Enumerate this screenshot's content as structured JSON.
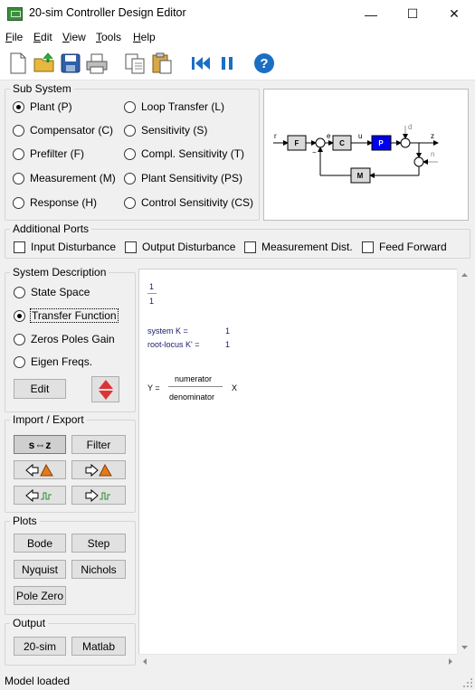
{
  "window": {
    "title": "20-sim Controller Design Editor",
    "minimize": "—",
    "maximize": "☐",
    "close": "✕"
  },
  "menu": [
    {
      "label": "File",
      "u": "F",
      "rest": "ile"
    },
    {
      "label": "Edit",
      "u": "E",
      "rest": "dit"
    },
    {
      "label": "View",
      "u": "V",
      "rest": "iew"
    },
    {
      "label": "Tools",
      "u": "T",
      "rest": "ools"
    },
    {
      "label": "Help",
      "u": "H",
      "rest": "elp"
    }
  ],
  "toolbar": [
    "new-file-icon",
    "open-folder-icon",
    "save-icon",
    "print-icon",
    "copy-icon",
    "paste-icon",
    "rewind-icon",
    "pause-icon",
    "help-icon"
  ],
  "subsystem": {
    "title": "Sub System",
    "left": [
      "Plant (P)",
      "Compensator (C)",
      "Prefilter (F)",
      "Measurement (M)",
      "Response (H)"
    ],
    "right": [
      "Loop Transfer (L)",
      "Sensitivity (S)",
      "Compl. Sensitivity (T)",
      "Plant Sensitivity (PS)",
      "Control Sensitivity (CS)"
    ],
    "selected": "Plant (P)"
  },
  "diagram": {
    "labels": {
      "r": "r",
      "F": "F",
      "e": "e",
      "C": "C",
      "u": "u",
      "P": "P",
      "z": "z",
      "d": "d",
      "n": "n",
      "M": "M",
      "minus": "−"
    }
  },
  "ports": {
    "title": "Additional Ports",
    "items": [
      "Input Disturbance",
      "Output Disturbance",
      "Measurement Dist.",
      "Feed Forward"
    ]
  },
  "sysdesc": {
    "title": "System Description",
    "options": [
      "State Space",
      "Transfer Function",
      "Zeros Poles Gain",
      "Eigen Freqs."
    ],
    "selected": "Transfer Function",
    "edit_label": "Edit"
  },
  "importexport": {
    "title": "Import / Export",
    "sz_label": "s⇔z",
    "filter_label": "Filter"
  },
  "plots": {
    "title": "Plots",
    "buttons": [
      "Bode",
      "Step",
      "Nyquist",
      "Nichols",
      "Pole Zero"
    ]
  },
  "output": {
    "title": "Output",
    "buttons": [
      "20-sim",
      "Matlab"
    ]
  },
  "content": {
    "frac_num": "1",
    "frac_den": "1",
    "system_k_label": "system K  =",
    "system_k_value": "1",
    "root_locus_label": "root-locus K'  =",
    "root_locus_value": "1",
    "y_label": "Y =",
    "numerator": "numerator",
    "denominator": "denominator",
    "x_label": "X"
  },
  "status": "Model loaded",
  "colors": {
    "plant_block": "#0000ee",
    "accent_blue": "#1a6fc4",
    "matlab_orange": "#e07b20"
  }
}
